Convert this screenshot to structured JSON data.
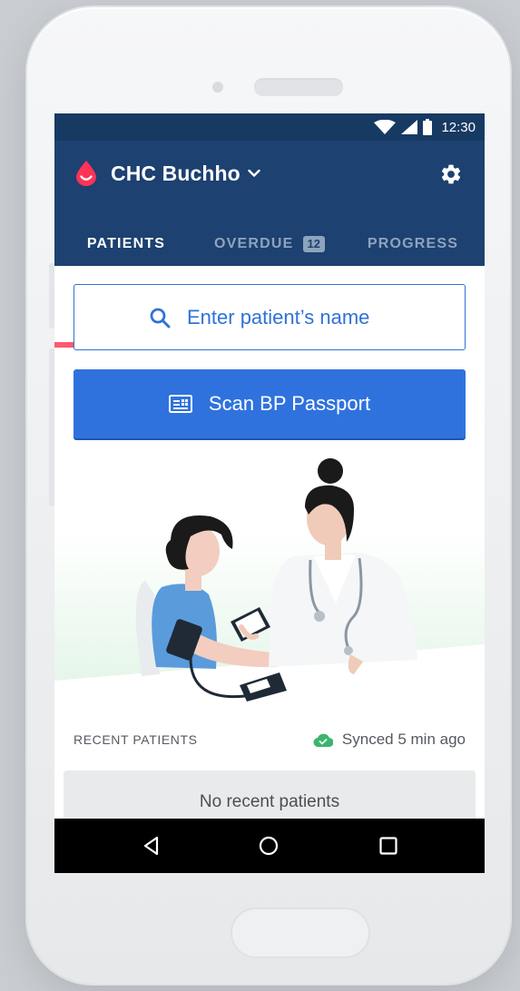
{
  "status_bar": {
    "time": "12:30"
  },
  "app_bar": {
    "facility_name": "CHC Buchho",
    "tabs": [
      {
        "label": "PATIENTS"
      },
      {
        "label": "OVERDUE",
        "badge": "12"
      },
      {
        "label": "PROGRESS"
      }
    ]
  },
  "search": {
    "placeholder": "Enter patient’s name"
  },
  "scan_button": {
    "label": "Scan BP Passport"
  },
  "recent": {
    "label": "RECENT PATIENTS",
    "sync_status": "Synced 5 min ago",
    "empty_text": "No recent patients"
  },
  "colors": {
    "status_bar": "#173a63",
    "app_bar": "#1d4170",
    "tab_indicator": "#ff5a6e",
    "primary": "#2f72de",
    "sync_green": "#3bb56c",
    "brand_red": "#ff3355"
  },
  "icons": [
    "wifi-icon",
    "signal-icon",
    "battery-icon",
    "blood-drop-icon",
    "chevron-down-icon",
    "gear-icon",
    "search-icon",
    "passport-icon",
    "cloud-check-icon",
    "back-icon",
    "home-circle-icon",
    "recents-square-icon"
  ]
}
